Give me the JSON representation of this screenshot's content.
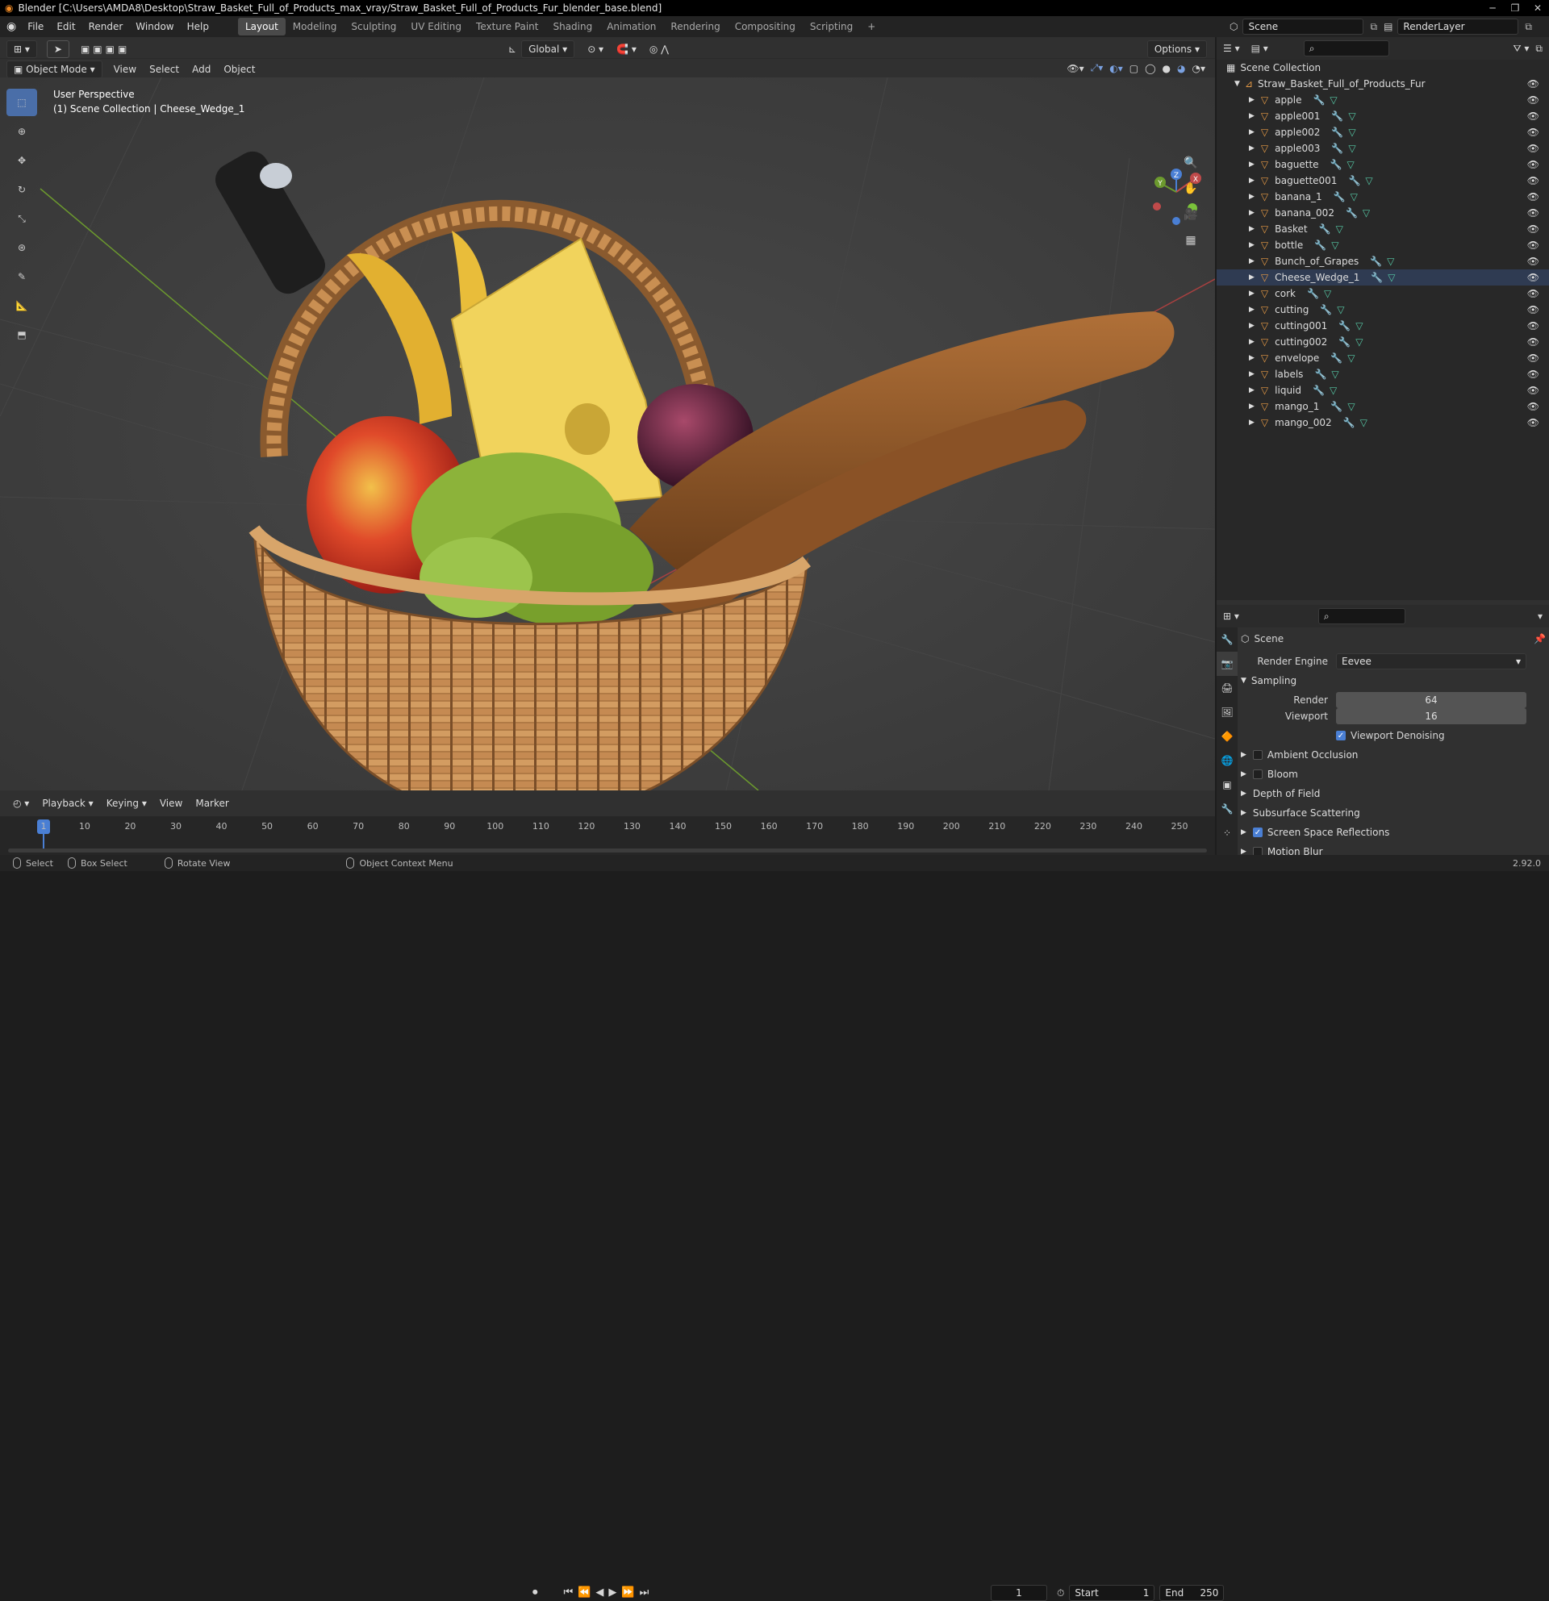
{
  "titlebar": {
    "title": "Blender [C:\\Users\\AMDA8\\Desktop\\Straw_Basket_Full_of_Products_max_vray/Straw_Basket_Full_of_Products_Fur_blender_base.blend]",
    "minimize": "─",
    "maximize": "❐",
    "close": "✕"
  },
  "menu": {
    "items": [
      "File",
      "Edit",
      "Render",
      "Window",
      "Help"
    ]
  },
  "workspaces": [
    "Layout",
    "Modeling",
    "Sculpting",
    "UV Editing",
    "Texture Paint",
    "Shading",
    "Animation",
    "Rendering",
    "Compositing",
    "Scripting"
  ],
  "workspace_add": "+",
  "scene": {
    "name": "Scene",
    "view_layer": "RenderLayer"
  },
  "viewport_header": {
    "transform_orientation": "Global",
    "options": "Options",
    "mode": "Object Mode",
    "menus": [
      "View",
      "Select",
      "Add",
      "Object"
    ]
  },
  "viewport": {
    "perspective": "User Perspective",
    "collection_info": "(1) Scene Collection | Cheese_Wedge_1",
    "gizmo": {
      "x": "X",
      "y": "Y",
      "z": "Z"
    }
  },
  "outliner": {
    "root": "Scene Collection",
    "collection": "Straw_Basket_Full_of_Products_Fur",
    "selected": "Cheese_Wedge_1",
    "objects": [
      "apple",
      "apple001",
      "apple002",
      "apple003",
      "baguette",
      "baguette001",
      "banana_1",
      "banana_002",
      "Basket",
      "bottle",
      "Bunch_of_Grapes",
      "Cheese_Wedge_1",
      "cork",
      "cutting",
      "cutting001",
      "cutting002",
      "envelope",
      "labels",
      "liquid",
      "mango_1",
      "mango_002"
    ]
  },
  "properties": {
    "context": "Scene",
    "render_engine_label": "Render Engine",
    "render_engine": "Eevee",
    "sampling_label": "Sampling",
    "render_label": "Render",
    "render_samples": "64",
    "viewport_label": "Viewport",
    "viewport_samples": "16",
    "denoise_label": "Viewport Denoising",
    "denoise": true,
    "sections": [
      {
        "label": "Ambient Occlusion",
        "checkbox": true,
        "checked": false
      },
      {
        "label": "Bloom",
        "checkbox": true,
        "checked": false
      },
      {
        "label": "Depth of Field",
        "checkbox": false,
        "checked": false
      },
      {
        "label": "Subsurface Scattering",
        "checkbox": false,
        "checked": false
      },
      {
        "label": "Screen Space Reflections",
        "checkbox": true,
        "checked": true
      },
      {
        "label": "Motion Blur",
        "checkbox": true,
        "checked": false
      }
    ]
  },
  "timeline": {
    "menus": [
      "Playback",
      "Keying",
      "View",
      "Marker"
    ],
    "current_frame": "1",
    "start_label": "Start",
    "start": "1",
    "end_label": "End",
    "end": "250",
    "ticks": [
      "1",
      "10",
      "20",
      "30",
      "40",
      "50",
      "60",
      "70",
      "80",
      "90",
      "100",
      "110",
      "120",
      "130",
      "140",
      "150",
      "160",
      "170",
      "180",
      "190",
      "200",
      "210",
      "220",
      "230",
      "240",
      "250"
    ]
  },
  "statusbar": {
    "select": "Select",
    "box_select": "Box Select",
    "rotate": "Rotate View",
    "context_menu": "Object Context Menu",
    "version": "2.92.0"
  },
  "colors": {
    "accent": "#4a7fd4",
    "active_tab": "#4a4a4a",
    "object_icon": "#e69a46",
    "mesh_icon": "#56c9a6",
    "modifier_icon": "#7aa1e0",
    "playhead": "#4a7fd4",
    "axis_x": "#c04a4a",
    "axis_y": "#6c9a2e"
  }
}
